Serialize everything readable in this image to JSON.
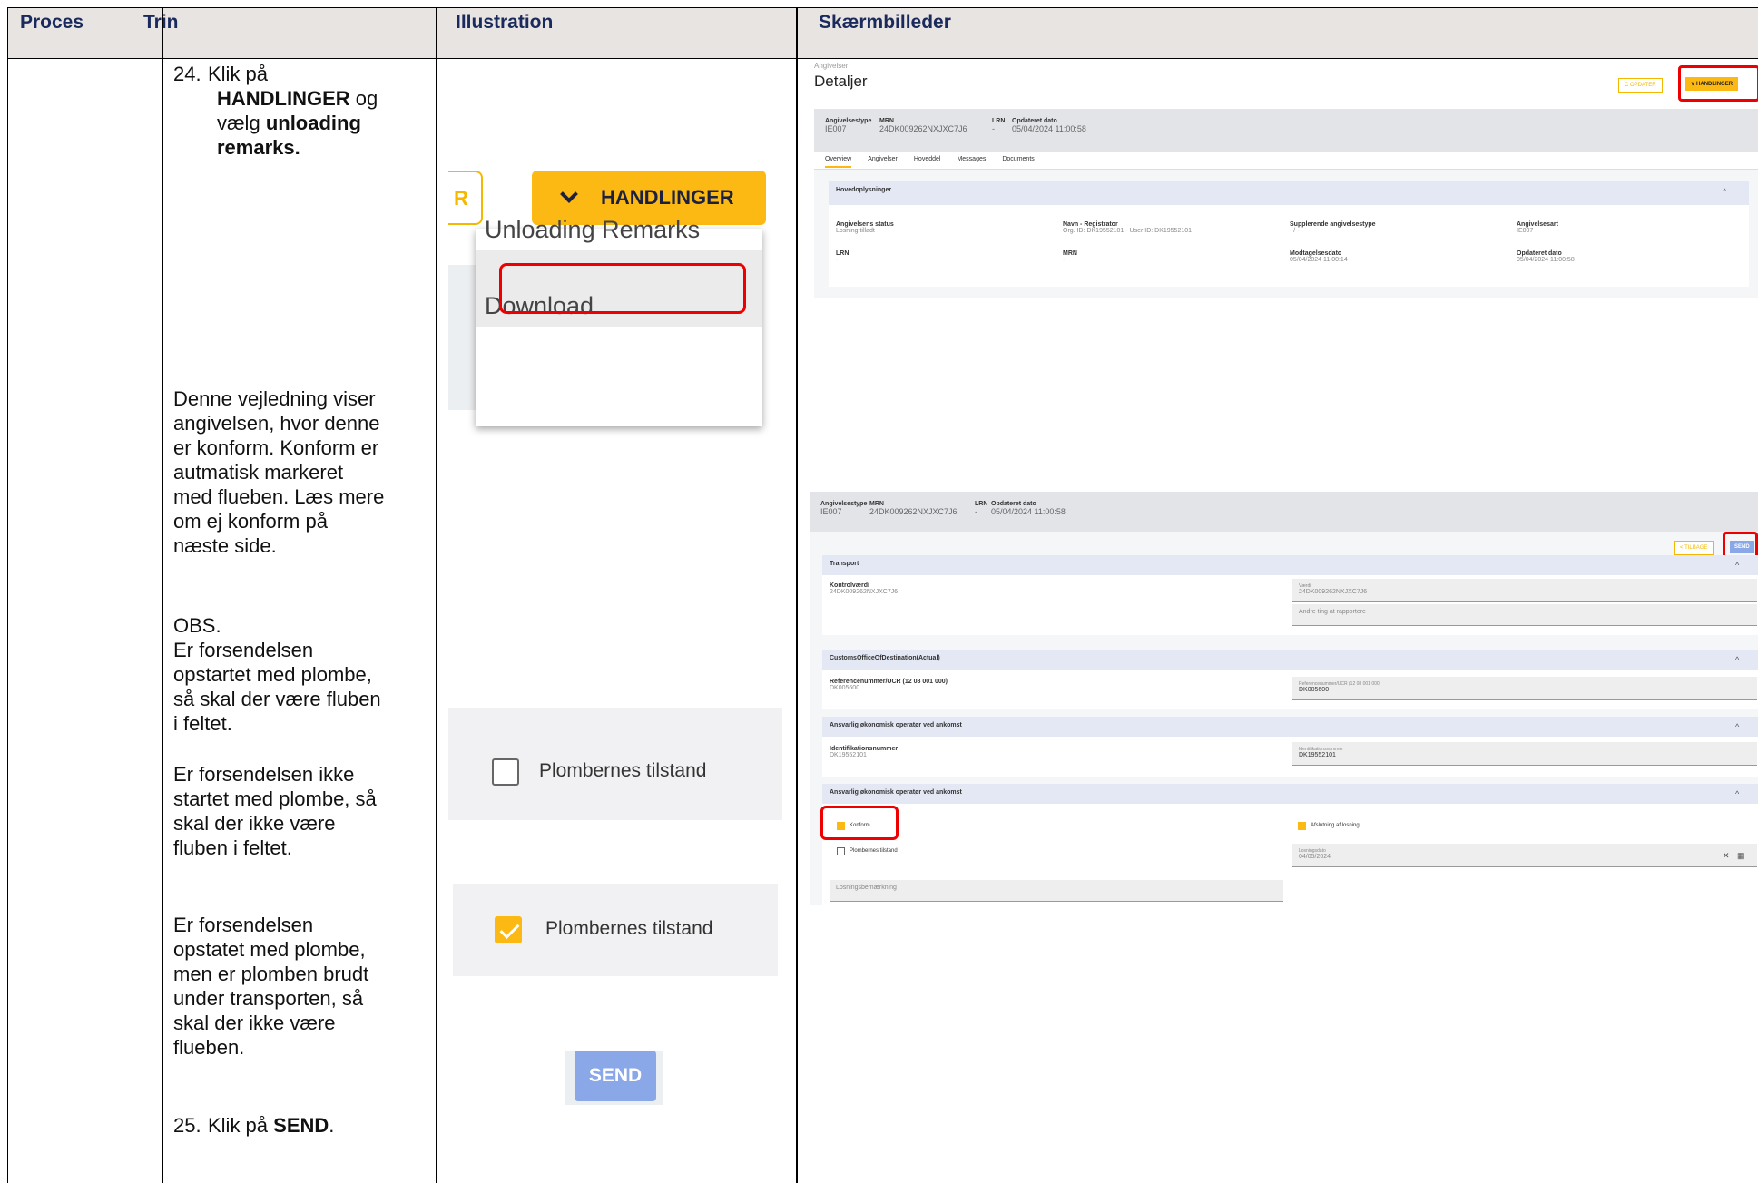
{
  "headers": [
    "Proces",
    "Trin",
    "Illustration",
    "Skærmbilleder"
  ],
  "trin": {
    "step24_num": "24.",
    "step24_a": "Klik på",
    "step24_b": "HANDLINGER",
    "step24_c": "og",
    "step24_d": "vælg",
    "step24_e": "unloading",
    "step24_f": "remarks.",
    "p1": [
      "Denne vejledning viser",
      "angivelsen, hvor denne",
      "er konform. Konform er",
      "autmatisk markeret",
      "med flueben. Læs mere",
      "om ej konform på",
      "næste side."
    ],
    "p2": [
      "OBS.",
      "Er forsendelsen",
      "opstartet med plombe,",
      "så skal der være fluben",
      "i feltet."
    ],
    "p3": [
      "Er forsendelsen ikke",
      "startet med plombe, så",
      "skal der ikke være",
      "fluben i feltet."
    ],
    "p4": [
      "Er forsendelsen",
      "opstatet med plombe,",
      "men er plomben brudt",
      "under transporten, så",
      "skal der ikke være",
      "flueben."
    ],
    "step25_num": "25.",
    "step25_a": "Klik på",
    "step25_b": "SEND",
    "step25_c": "."
  },
  "illustration": {
    "outline_btn_fragment": "R",
    "handlinger_label": "HANDLINGER",
    "menu_items": [
      "Unloading Remarks",
      "Download"
    ],
    "unchecked_label": "Plombernes tilstand",
    "checked_label": "Plombernes tilstand",
    "send_label": "SEND"
  },
  "screenshot1": {
    "crumb": "Angivelser",
    "title": "Detaljer",
    "btn_opdater": "C OPDATER",
    "btn_handlinger": "∨ HANDLINGER",
    "band": [
      {
        "label": "Angivelsestype",
        "value": "IE007"
      },
      {
        "label": "MRN",
        "value": "24DK009262NXJXC7J6"
      },
      {
        "label": "LRN",
        "value": "-"
      },
      {
        "label": "Opdateret dato",
        "value": "05/04/2024 11:00:58"
      }
    ],
    "tabs": [
      "Overview",
      "Angivelser",
      "Hoveddel",
      "Messages",
      "Documents"
    ],
    "section": "Hovedoplysninger",
    "fields": [
      {
        "label": "Angivelsens status",
        "value": "Losning tilladt"
      },
      {
        "label": "Navn - Registrator",
        "value": "Org. ID: DK19552101 - User ID: DK19552101"
      },
      {
        "label": "Supplerende angivelsestype",
        "value": "- / -"
      },
      {
        "label": "Angivelsesart",
        "value": "IE007"
      },
      {
        "label": "LRN",
        "value": "-"
      },
      {
        "label": "MRN",
        "value": "-"
      },
      {
        "label": "Modtagelsesdato",
        "value": "05/04/2024 11:00:14"
      },
      {
        "label": "Opdateret dato",
        "value": "05/04/2024 11:00:58"
      }
    ]
  },
  "screenshot2": {
    "band": [
      {
        "label": "Angivelsestype",
        "value": "IE007"
      },
      {
        "label": "MRN",
        "value": "24DK009262NXJXC7J6"
      },
      {
        "label": "LRN",
        "value": "-"
      },
      {
        "label": "Opdateret dato",
        "value": "05/04/2024 11:00:58"
      }
    ],
    "btn_tilbage": "< TILBAGE",
    "btn_send": "SEND",
    "sections": [
      "Transport",
      "CustomsOfficeOfDestination(Actual)",
      "Ansvarlig økonomisk operatør ved ankomst",
      "Ansvarlig økonomisk operatør ved ankomst"
    ],
    "transport_label": "Kontrolværdi",
    "transport_value": "24DK009262NXJXC7J6",
    "transport_field_small": "Værdi",
    "transport_field_value": "24DK009262NXJXC7J6",
    "transport_field2": "Andre ting at rapportere",
    "customs_label": "Referencenummer/UCR (12 08 001 000)",
    "customs_value": "DK005600",
    "customs_field_small": "Referencenummer/UCR (12 08 001 000)",
    "customs_field_value": "DK005600",
    "oper_label": "Identifikationsnummer",
    "oper_value": "DK19552101",
    "oper_field_small": "Identifikationsnummer",
    "oper_field_value": "DK19552101",
    "chk_konform": "Konform",
    "chk_afslutning": "Afslutning af losning",
    "chk_plomber": "Plombernes tilstand",
    "losningsdato_small": "Losningsdato",
    "losningsdato_value": "04/05/2024",
    "remark_placeholder": "Losningsbemærkning"
  }
}
